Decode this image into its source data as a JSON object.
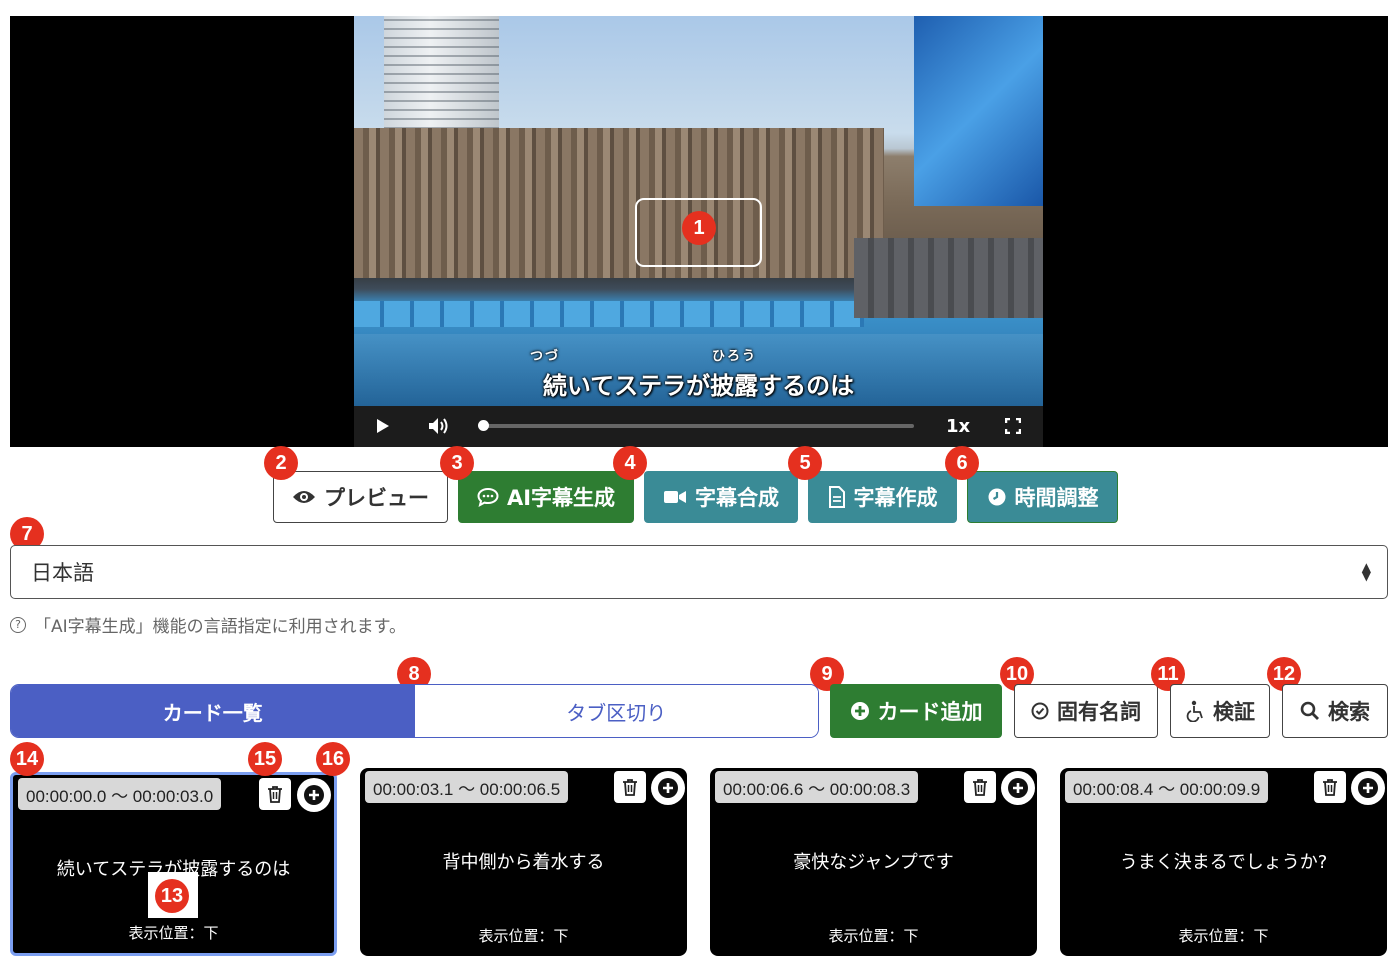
{
  "video": {
    "subtitle": "続いてステラが披露するのは",
    "ruby_1": "つづ",
    "ruby_2": "ひろう",
    "speed": "1x"
  },
  "markers": [
    "1",
    "2",
    "3",
    "4",
    "5",
    "6",
    "7",
    "8",
    "9",
    "10",
    "11",
    "12",
    "13",
    "14",
    "15",
    "16"
  ],
  "actions": {
    "preview": "プレビュー",
    "ai_subtitle": "AI字幕生成",
    "merge": "字幕合成",
    "create": "字幕作成",
    "timing": "時間調整"
  },
  "language": {
    "selected": "日本語",
    "help": "「AI字幕生成」機能の言語指定に利用されます。",
    "help_icon": "?"
  },
  "tabs": {
    "cards": "カード一覧",
    "split": "タブ区切り"
  },
  "toolbar": {
    "add_card": "カード追加",
    "proper_nouns": "固有名詞",
    "verify": "検証",
    "search": "検索"
  },
  "cards": [
    {
      "time": "00:00:00.0 〜 00:00:03.0",
      "text": "続いてステラが披露するのは",
      "position": "表示位置：下"
    },
    {
      "time": "00:00:03.1 〜 00:00:06.5",
      "text": "背中側から着水する",
      "position": "表示位置：下"
    },
    {
      "time": "00:00:06.6 〜 00:00:08.3",
      "text": "豪快なジャンプです",
      "position": "表示位置：下"
    },
    {
      "time": "00:00:08.4 〜 00:00:09.9",
      "text": "うまく決まるでしょうか?",
      "position": "表示位置：下"
    }
  ],
  "colors": {
    "primary": "#4b5fc4",
    "success": "#2e7d32",
    "teal": "#3a8b96",
    "marker": "#e5301f"
  }
}
